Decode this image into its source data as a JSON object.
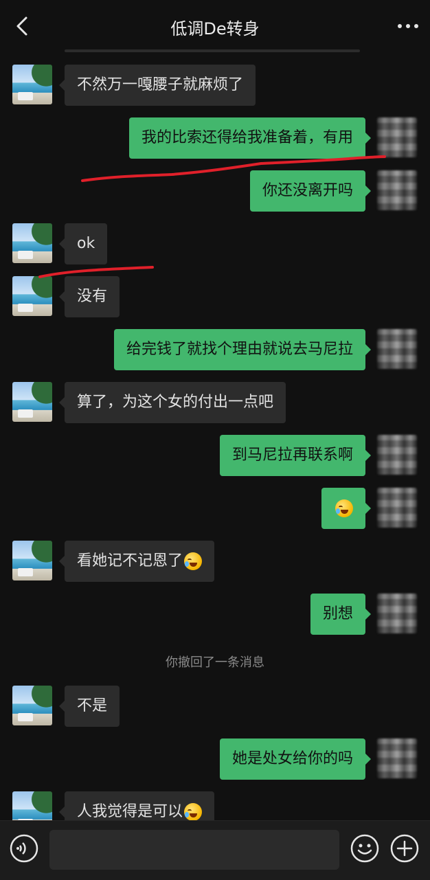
{
  "header": {
    "title": "低调De转身",
    "back_icon": "chevron-left-icon",
    "more_icon": "ellipsis-icon"
  },
  "messages": [
    {
      "side": "recv",
      "text": "不然万一嘎腰子就麻烦了"
    },
    {
      "side": "sent",
      "text": "我的比索还得给我准备着，有用"
    },
    {
      "side": "sent",
      "text": "你还没离开吗"
    },
    {
      "side": "recv",
      "text": "ok"
    },
    {
      "side": "recv",
      "text": "没有"
    },
    {
      "side": "sent",
      "text": "给完钱了就找个理由就说去马尼拉"
    },
    {
      "side": "recv",
      "text": "算了，为这个女的付出一点吧"
    },
    {
      "side": "sent",
      "text": "到马尼拉再联系啊"
    },
    {
      "side": "sent",
      "text": "",
      "emoji": "laugh-cry-emoji"
    },
    {
      "side": "recv",
      "text": "看她记不记恩了",
      "emoji": "laugh-cry-emoji"
    },
    {
      "side": "sent",
      "text": "别想"
    },
    {
      "side": "system",
      "text": "你撤回了一条消息"
    },
    {
      "side": "recv",
      "text": "不是"
    },
    {
      "side": "sent",
      "text": "她是处女给你的吗"
    },
    {
      "side": "recv",
      "text": "人我觉得是可以",
      "emoji": "laugh-cry-emoji"
    }
  ],
  "input_bar": {
    "voice_icon": "voice-icon",
    "emoji_icon": "smiley-icon",
    "plus_icon": "plus-circle-icon",
    "placeholder": ""
  },
  "colors": {
    "background": "#111111",
    "sent_bubble": "#43b76d",
    "recv_bubble": "#2c2c2c",
    "annotation_red": "#e0202a"
  }
}
